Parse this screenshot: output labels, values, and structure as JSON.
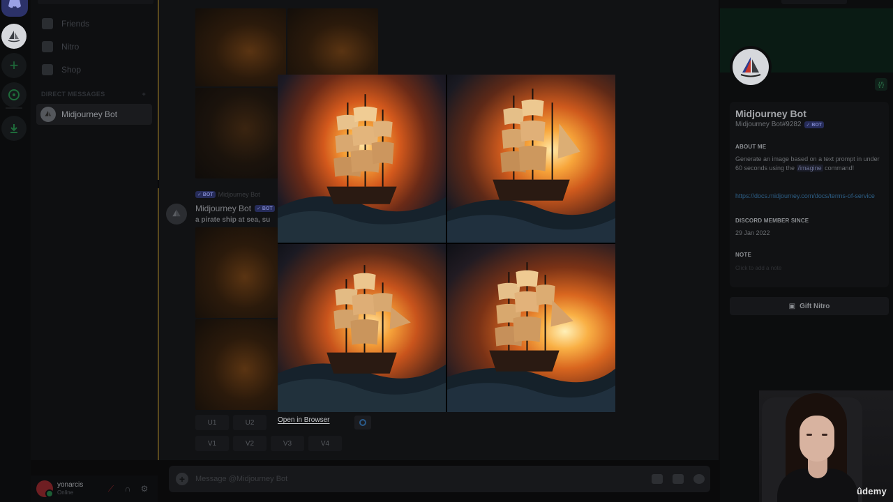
{
  "sidebar": {
    "nav": [
      {
        "label": "Friends",
        "icon": "friends-icon"
      },
      {
        "label": "Nitro",
        "icon": "nitro-icon"
      },
      {
        "label": "Shop",
        "icon": "shop-icon"
      }
    ],
    "dm_header": "DIRECT MESSAGES",
    "dm_add": "+",
    "dm_items": [
      {
        "label": "Midjourney Bot"
      }
    ]
  },
  "user": {
    "name": "yonarcis",
    "status": "Online"
  },
  "chat": {
    "bot_tag": "✓ BOT",
    "reply_author": "Midjourney Bot",
    "author": "Midjourney Bot",
    "prompt": "a pirate ship at sea, su",
    "buttons_row1": [
      "U1",
      "U2",
      "U3",
      "U4"
    ],
    "buttons_row2": [
      "V1",
      "V2",
      "V3",
      "V4"
    ],
    "composer_placeholder": "Message @Midjourney Bot"
  },
  "lightbox": {
    "open_in_browser": "Open in Browser"
  },
  "profile": {
    "name": "Midjourney Bot",
    "tag": "Midjourney Bot#9282",
    "bot_tag": "✓ BOT",
    "about_heading": "ABOUT ME",
    "about_text_1": "Generate an image based on a text prompt in under 60 seconds using the ",
    "about_cmd": "/imagine",
    "about_text_2": " command!",
    "link": "https://docs.midjourney.com/docs/terms-of-service",
    "member_since_heading": "DISCORD MEMBER SINCE",
    "member_since": "29 Jan 2022",
    "note_heading": "NOTE",
    "note_placeholder": "Click to add a note",
    "gift_button": "Gift Nitro",
    "badge": "{/}"
  },
  "watermark": "ûdemy",
  "colors": {
    "accent": "#5865f2",
    "online": "#23a55a",
    "link": "#00a8fc"
  }
}
